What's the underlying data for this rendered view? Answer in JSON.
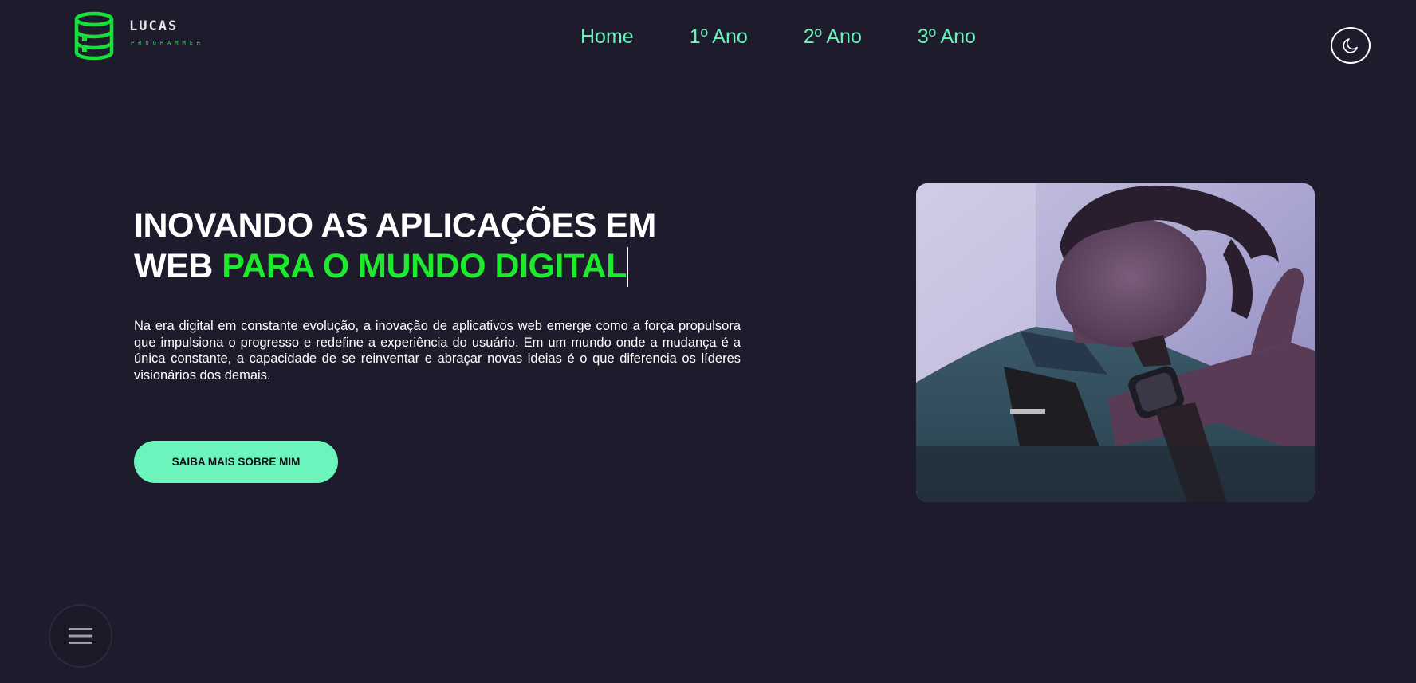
{
  "brand": {
    "name": "LUCAS",
    "tagline": "PROGRAMMER",
    "icon": "database-icon",
    "accent_color": "#1eea2d"
  },
  "nav": {
    "items": [
      {
        "label": "Home"
      },
      {
        "label": "1º Ano"
      },
      {
        "label": "2º Ano"
      },
      {
        "label": "3º Ano"
      }
    ],
    "color": "#6bf2bb"
  },
  "theme_toggle": {
    "icon": "moon-icon"
  },
  "hero": {
    "title_line1": "INOVANDO AS APLICAÇÕES EM",
    "title_line2_plain": "WEB ",
    "title_line2_accent": "PARA O MUNDO DIGITAL",
    "paragraph": "Na era digital em constante evolução, a inovação de aplicativos web emerge como a força propulsora que impulsiona o progresso e redefine a experiência do usuário. Em um mundo onde a mudança é a única constante, a capacidade de se reinventar e abraçar novas ideias é o que diferencia os líderes visionários dos demais.",
    "cta_label": "SAIBA MAIS SOBRE MIM"
  },
  "photo": {
    "subject": "profile-photo"
  },
  "floating_menu": {
    "icon": "hamburger-menu-icon"
  },
  "colors": {
    "background": "#1e1b2d",
    "button": "#6bf5bd",
    "heading_accent": "#1eea2d"
  }
}
